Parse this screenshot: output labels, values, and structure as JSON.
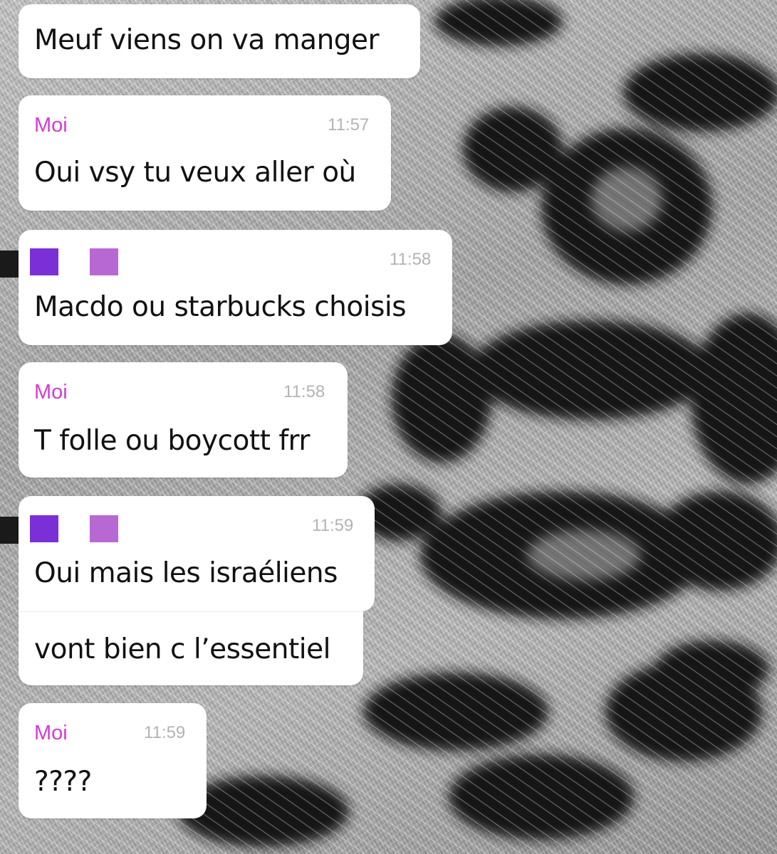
{
  "colors": {
    "sender_name": "#d53bd0",
    "timestamp": "#b3b3b3",
    "avatar_dark": "#7b2fd6",
    "avatar_light": "#b868d3",
    "bubble": "#ffffff",
    "text": "#111111"
  },
  "messages": [
    {
      "sender": "",
      "time": "",
      "lines": [
        "Meuf viens on va manger"
      ]
    },
    {
      "sender": "Moi",
      "time": "11:57",
      "lines": [
        "Oui vsy tu veux aller où"
      ]
    },
    {
      "sender": "",
      "time": "11:58",
      "lines": [
        "Macdo ou starbucks choisis"
      ]
    },
    {
      "sender": "Moi",
      "time": "11:58",
      "lines": [
        "T folle ou boycott frr"
      ]
    },
    {
      "sender": "",
      "time": "11:59",
      "lines": [
        "Oui mais les israéliens",
        "vont bien c l’essentiel"
      ]
    },
    {
      "sender": "Moi",
      "time": "11:59",
      "lines": [
        "????"
      ]
    }
  ]
}
